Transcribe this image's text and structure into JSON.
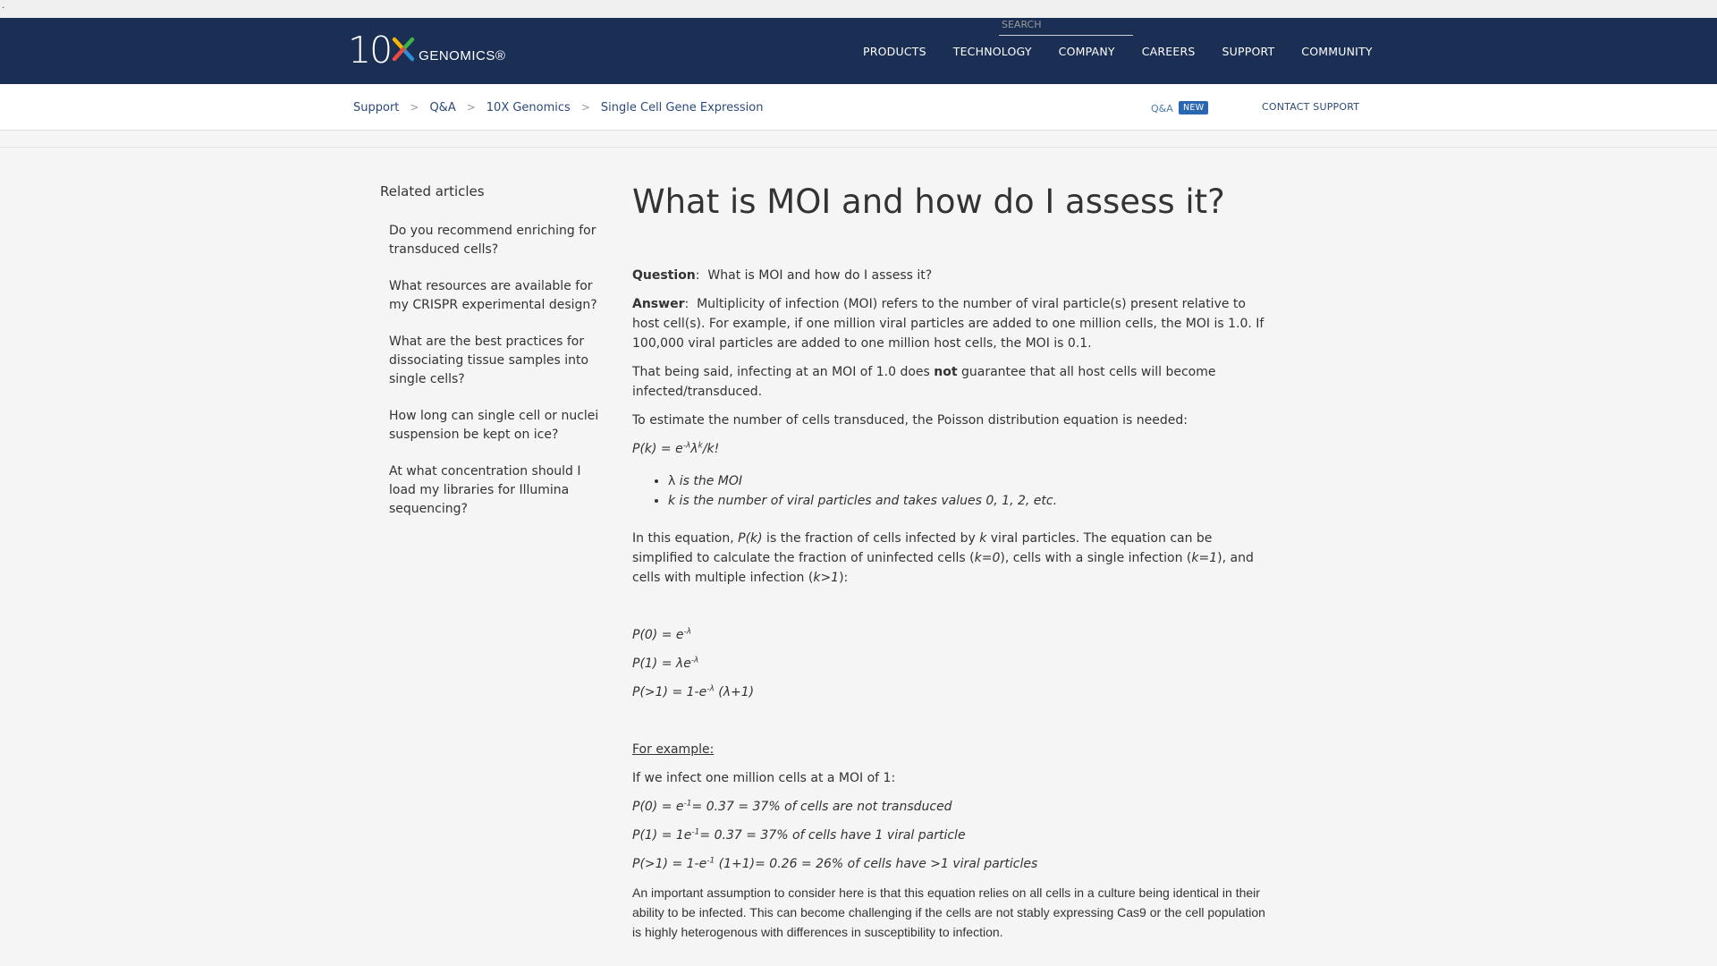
{
  "header": {
    "logo_number": "10",
    "logo_x": "X",
    "logo_word": "GENOMICS®",
    "nav": [
      "PRODUCTS",
      "TECHNOLOGY",
      "COMPANY",
      "CAREERS",
      "SUPPORT",
      "COMMUNITY"
    ]
  },
  "subbar": {
    "breadcrumbs": [
      "Support",
      "Q&A",
      "10X Genomics",
      "Single Cell Gene Expression"
    ],
    "breadcrumb_sep": ">",
    "search_placeholder": "SEARCH",
    "qa_label": "Q&A",
    "new_badge": "NEW",
    "contact_label": "CONTACT SUPPORT"
  },
  "sidebar": {
    "title": "Related articles",
    "articles": [
      "Do you recommend enriching for transduced cells?",
      "What resources are available for my CRISPR experimental design?",
      "What are the best practices for dissociating tissue samples into single cells?",
      "How long can single cell or nuclei suspension be kept on ice?",
      "At what concentration should I load my libraries for Illumina sequencing?"
    ]
  },
  "article": {
    "title": "What is MOI and how do I assess it?",
    "question_label": "Question",
    "question_text": "What is MOI and how do I assess it?",
    "answer_label": "Answer",
    "answer_text": "Multiplicity of infection (MOI) refers to the number of viral particle(s) present relative to host cell(s). For example, if one million viral particles are added to one million cells, the MOI is 1.0. If 100,000 viral particles are added to one million host cells, the MOI is 0.1.",
    "para2_a": "That being said, infecting at an MOI of 1.0 does ",
    "para2_bold": "not",
    "para2_b": " guarantee that all host cells will become infected/transduced.",
    "para3": "To estimate the number of cells transduced, the Poisson distribution equation is needed:",
    "eq_main": {
      "a": "P(k) = e",
      "sup1": "-λ",
      "b": "λ",
      "sup2": "k",
      "c": "/k!"
    },
    "bullet1_sym": "λ",
    "bullet1_text": " is the MOI",
    "bullet2": "k is the number of viral particles and takes values 0, 1, 2, etc.",
    "para4": {
      "a": "In this equation, ",
      "pk": "P(k)",
      "b": " is the fraction of cells infected by ",
      "k": "k",
      "c": " viral particles. The equation can be simplified to calculate the fraction of uninfected cells (",
      "k0": "k=0",
      "d": "), cells with a single infection (",
      "k1": "k=1",
      "e": "), and cells with multiple infection (",
      "kg1": "k>1",
      "f": "):"
    },
    "eq0": {
      "a": "P(0) = e",
      "sup": "-λ"
    },
    "eq1": {
      "a": "P(1) = λe",
      "sup": "-λ"
    },
    "eq2": {
      "a": "P(>1) = 1-e",
      "sup": "-λ",
      "b": " (λ+1)"
    },
    "example_heading": "For example:",
    "example_intro": "If we infect one million cells at a MOI of 1:",
    "ex0": {
      "a": "P(0) = e",
      "sup": "-1",
      "b": "= 0.37 = 37% of cells are not transduced"
    },
    "ex1": {
      "a": "P(1) = 1e",
      "sup": "-1",
      "b": "= 0.37 = 37% of cells have 1 viral particle"
    },
    "ex2": {
      "a": "P(>1) = 1-e",
      "sup": "-1",
      "b": " (1+1)= 0.26 = 26% of cells have >1 viral particles"
    },
    "final_para": "An important assumption to consider here is that this equation relies on all cells in a culture being identical in their ability to be infected. This can become challenging if the cells are not stably expressing Cas9 or the cell population is highly heterogenous with differences in susceptibility to infection."
  },
  "colors": {
    "navbar": "#1b2f54",
    "logo_x_gradient": [
      "#e84c3d",
      "#f5b400",
      "#3ab54a",
      "#2b8fd6"
    ],
    "badge": "#2b67b0",
    "link": "#2b4a7a"
  }
}
